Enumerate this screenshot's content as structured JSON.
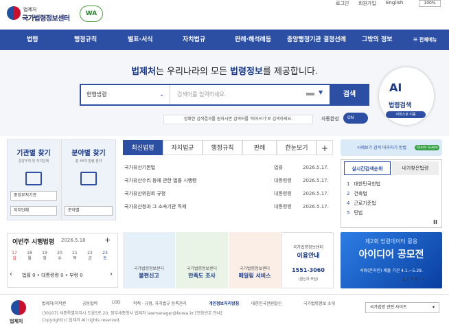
{
  "header": {
    "logo_small": "법제처",
    "logo_main": "국가법령정보센터",
    "badge": "WA",
    "top_links": [
      "로그인",
      "회원가입",
      "English"
    ],
    "font_size": "100%"
  },
  "nav": {
    "items": [
      "법령",
      "행정규칙",
      "별표·서식",
      "자치법규",
      "판례·해석례등",
      "중앙행정기관 결정선례",
      "그밖의 정보",
      "전체메뉴"
    ]
  },
  "hero": {
    "title_bold1": "법제처",
    "title_mid": "는 우리나라의 모든 ",
    "title_bold2": "법령정보",
    "title_end": "를 제공합니다.",
    "select_value": "현행법령",
    "search_placeholder": "검색어를 입력하세요.",
    "search_button": "검색",
    "hint": "정확한 검색결과를 원하시면 검색어를 '띄어쓰기'로 검색하세요.",
    "autocomplete_label": "자동완성",
    "toggle_label": "ON",
    "ai_title": "AI",
    "ai_sub": "법령검색",
    "ai_pill": "서비스로 이동"
  },
  "finder": {
    "org_title": "기관별 찾기",
    "org_sub": "중앙부처 및 자치단체",
    "cat_title": "분야별 찾기",
    "cat_sub": "총 44개 법령 분야",
    "org_select1": "중앙부처기관",
    "org_select2": "자치단체",
    "cat_select": "분야별"
  },
  "tabs": [
    "최신법령",
    "자치법규",
    "행정규칙",
    "판례",
    "한눈보기"
  ],
  "latest_laws": [
    {
      "title": "국가유산기본법",
      "type": "법률",
      "date": "2026.5.17."
    },
    {
      "title": "국가유산수리 등에 관한 법률 시행령",
      "type": "대통령령",
      "date": "2026.5.17."
    },
    {
      "title": "국가유산위원회 규정",
      "type": "대통령령",
      "date": "2026.5.17."
    },
    {
      "title": "국가유산청과 그 소속기관 직제",
      "type": "대통령령",
      "date": "2026.5.17."
    }
  ],
  "quick_guide": {
    "text": "사례보기 검색 따라하기 방법",
    "badge": "Quick Guide"
  },
  "ranking": {
    "tabs": [
      "실시간검색순위",
      "내가찾은법령"
    ],
    "items": [
      "대한민국헌법",
      "건축법",
      "근로기준법",
      "민법"
    ]
  },
  "weekly": {
    "title": "이번주 시행법령",
    "date": "2026.5.18",
    "days": [
      [
        "17",
        "일"
      ],
      [
        "18",
        "월"
      ],
      [
        "19",
        "화"
      ],
      [
        "20",
        "수"
      ],
      [
        "21",
        "목"
      ],
      [
        "22",
        "금"
      ],
      [
        "23",
        "토"
      ]
    ],
    "counts": "법률 0 • 대통령령 0 • 부령 0"
  },
  "services": [
    {
      "label": "국가법령정보센터",
      "title": "불편신고"
    },
    {
      "label": "국가법령정보센터",
      "title": "만족도 조사"
    },
    {
      "label": "국가법령정보센터",
      "title": "메일링 서비스"
    },
    {
      "label": "국가법령정보센터",
      "title": "이용안내",
      "phone": "1551-3060",
      "note": "(발신자 부담)"
    }
  ],
  "banner": {
    "line1": "제2회 법령데이터 활용",
    "line2": "아이디어 공모전",
    "line3": "서류(온라인) 제출 기간 4.1.~5.29.",
    "pager": "1 / 7"
  },
  "footer": {
    "logo_text": "법제처",
    "links": [
      "법제처/저작권",
      "공동협력",
      "LOD",
      "학적 · 규정, 자치법규 등록관리",
      "개인정보처리방침",
      "대한민국전원발신",
      "국가법령정보 소개"
    ],
    "address1": "(30107) 세종특별자치시 도움5로 20, 정부세종청사 법제처 lawmanager@korea.kr [전화번호 안내]",
    "address2": "Copyright(c) 법제처 All rights reserved.",
    "site_select": "국가법령 관련 사이트"
  },
  "colors": {
    "primary": "#2c4fa3",
    "dark_navy": "#1b3a86"
  }
}
